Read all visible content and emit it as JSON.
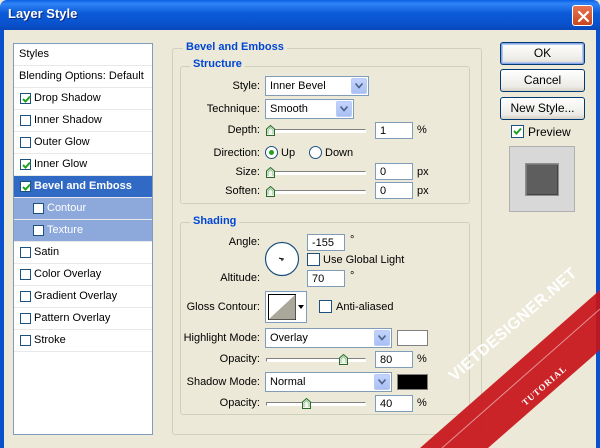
{
  "window": {
    "title": "Layer Style"
  },
  "styles_list": {
    "items": [
      {
        "label": "Styles",
        "checked": false,
        "has_checkbox": false,
        "selected": false,
        "sub": false
      },
      {
        "label": "Blending Options: Default",
        "checked": false,
        "has_checkbox": false,
        "selected": false,
        "sub": false
      },
      {
        "label": "Drop Shadow",
        "checked": true,
        "has_checkbox": true,
        "selected": false,
        "sub": false
      },
      {
        "label": "Inner Shadow",
        "checked": false,
        "has_checkbox": true,
        "selected": false,
        "sub": false
      },
      {
        "label": "Outer Glow",
        "checked": false,
        "has_checkbox": true,
        "selected": false,
        "sub": false
      },
      {
        "label": "Inner Glow",
        "checked": true,
        "has_checkbox": true,
        "selected": false,
        "sub": false
      },
      {
        "label": "Bevel and Emboss",
        "checked": true,
        "has_checkbox": true,
        "selected": true,
        "sub": false
      },
      {
        "label": "Contour",
        "checked": false,
        "has_checkbox": true,
        "selected": false,
        "sub": true
      },
      {
        "label": "Texture",
        "checked": false,
        "has_checkbox": true,
        "selected": false,
        "sub": true
      },
      {
        "label": "Satin",
        "checked": false,
        "has_checkbox": true,
        "selected": false,
        "sub": false
      },
      {
        "label": "Color Overlay",
        "checked": false,
        "has_checkbox": true,
        "selected": false,
        "sub": false
      },
      {
        "label": "Gradient Overlay",
        "checked": false,
        "has_checkbox": true,
        "selected": false,
        "sub": false
      },
      {
        "label": "Pattern Overlay",
        "checked": false,
        "has_checkbox": true,
        "selected": false,
        "sub": false
      },
      {
        "label": "Stroke",
        "checked": false,
        "has_checkbox": true,
        "selected": false,
        "sub": false
      }
    ]
  },
  "bevel": {
    "title": "Bevel and Emboss",
    "structure": {
      "title": "Structure",
      "style_label": "Style:",
      "style_value": "Inner Bevel",
      "technique_label": "Technique:",
      "technique_value": "Smooth",
      "depth_label": "Depth:",
      "depth_value": "1",
      "depth_unit": "%",
      "depth_level": 0.0,
      "direction_label": "Direction:",
      "direction_up": "Up",
      "direction_down": "Down",
      "direction_selected": "Up",
      "size_label": "Size:",
      "size_value": "0",
      "size_unit": "px",
      "size_level": 0.0,
      "soften_label": "Soften:",
      "soften_value": "0",
      "soften_unit": "px",
      "soften_level": 0.0
    },
    "shading": {
      "title": "Shading",
      "angle_label": "Angle:",
      "angle_value": "-155",
      "angle_unit": "°",
      "global_light_label": "Use Global Light",
      "global_light_checked": false,
      "altitude_label": "Altitude:",
      "altitude_value": "70",
      "altitude_unit": "°",
      "gloss_contour_label": "Gloss Contour:",
      "anti_aliased_label": "Anti-aliased",
      "anti_aliased_checked": false,
      "highlight_mode_label": "Highlight Mode:",
      "highlight_mode_value": "Overlay",
      "highlight_color": "#ffffff",
      "highlight_opacity_label": "Opacity:",
      "highlight_opacity_value": "80",
      "highlight_opacity_unit": "%",
      "highlight_opacity_level": 0.8,
      "shadow_mode_label": "Shadow Mode:",
      "shadow_mode_value": "Normal",
      "shadow_color": "#000000",
      "shadow_opacity_label": "Opacity:",
      "shadow_opacity_value": "40",
      "shadow_opacity_unit": "%",
      "shadow_opacity_level": 0.4
    }
  },
  "buttons": {
    "ok": "OK",
    "cancel": "Cancel",
    "new_style": "New Style...",
    "preview_label": "Preview",
    "preview_checked": true
  },
  "colors": {
    "accent": "#0a52cd",
    "selection": "#316ac5",
    "group_title": "#0046d5"
  }
}
